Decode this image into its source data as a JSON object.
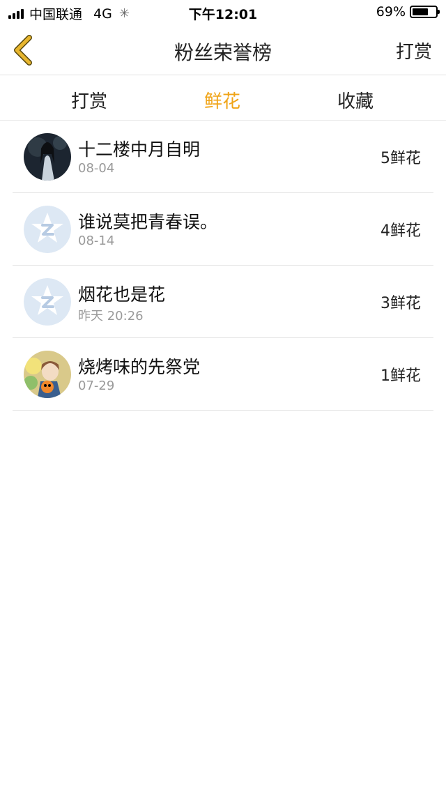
{
  "status_bar": {
    "carrier": "中国联通",
    "network": "4G",
    "time": "下午12:01",
    "battery": "69%",
    "battery_level": 0.69
  },
  "nav": {
    "title": "粉丝荣誉榜",
    "right_label": "打赏"
  },
  "tabs": [
    {
      "label": "打赏",
      "active": false
    },
    {
      "label": "鲜花",
      "active": true
    },
    {
      "label": "收藏",
      "active": false
    }
  ],
  "list": [
    {
      "name": "十二楼中月自明",
      "date": "08-04",
      "count": "5鲜花",
      "avatar": "photo-avatar-girl"
    },
    {
      "name": "谁说莫把青春误。",
      "date": "08-14",
      "count": "4鲜花",
      "avatar": "default-qq-avatar"
    },
    {
      "name": "烟花也是花",
      "date": "昨天 20:26",
      "count": "3鲜花",
      "avatar": "default-qq-avatar"
    },
    {
      "name": "烧烤味的先祭党",
      "date": "07-29",
      "count": "1鲜花",
      "avatar": "photo-avatar-anime"
    }
  ],
  "colors": {
    "accent": "#f0a417",
    "back_arrow": "#e8b62e",
    "divider": "#e4e4e4",
    "secondary_text": "#9a9a9a"
  }
}
